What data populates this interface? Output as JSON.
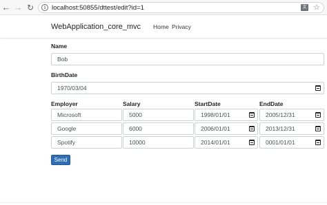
{
  "browser": {
    "url": "localhost:50855/dttest/edit?id=1",
    "back_glyph": "←",
    "forward_glyph": "→",
    "reload_glyph": "↻",
    "info_glyph": "i",
    "translate_glyph": "文",
    "star_glyph": "☆"
  },
  "nav": {
    "brand": "WebApplication_core_mvc",
    "links": [
      "Home",
      "Privacy"
    ]
  },
  "form": {
    "name_label": "Name",
    "name_value": "Bob",
    "birthdate_label": "BirthDate",
    "birthdate_value": "1970/03/04",
    "table_headers": [
      "Employer",
      "Salary",
      "StartDate",
      "EndDate"
    ],
    "jobs": [
      {
        "employer": "Microsoft",
        "salary": "5000",
        "start": "1998/01/01",
        "end": "2005/12/31"
      },
      {
        "employer": "Google",
        "salary": "6000",
        "start": "2006/01/01",
        "end": "2013/12/31"
      },
      {
        "employer": "Spotify",
        "salary": "10000",
        "start": "2014/01/01",
        "end": "0001/01/01"
      }
    ],
    "send_label": "Send"
  }
}
